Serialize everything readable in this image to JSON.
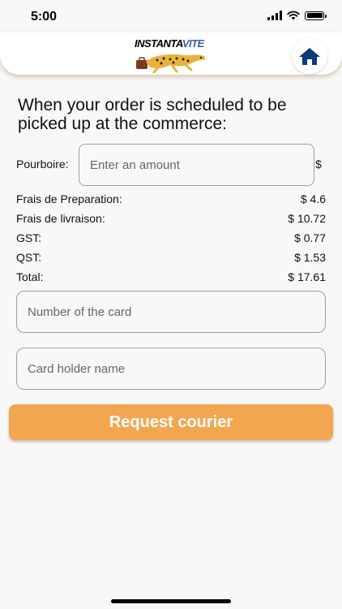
{
  "status_bar": {
    "time": "5:00"
  },
  "header": {
    "logo_text_a": "INSTANTA",
    "logo_text_b": "VITE",
    "home_icon": "home-icon",
    "brand_blue": "#0d3b78"
  },
  "heading": "When your order is scheduled to be picked up at the commerce:",
  "tip": {
    "label": "Pourboire:",
    "placeholder": "Enter an amount",
    "currency": "$"
  },
  "fees": [
    {
      "label": "Frais de Preparation:",
      "value": "$ 4.6"
    },
    {
      "label": "Frais de livraison:",
      "value": "$ 10.72"
    },
    {
      "label": "GST:",
      "value": "$ 0.77"
    },
    {
      "label": "QST:",
      "value": "$ 1.53"
    },
    {
      "label": "Total:",
      "value": "$ 17.61"
    }
  ],
  "card_number": {
    "placeholder": "Number of the card"
  },
  "card_holder": {
    "placeholder": "Card holder name"
  },
  "request_button": {
    "label": "Request courier",
    "color": "#f3a650"
  }
}
